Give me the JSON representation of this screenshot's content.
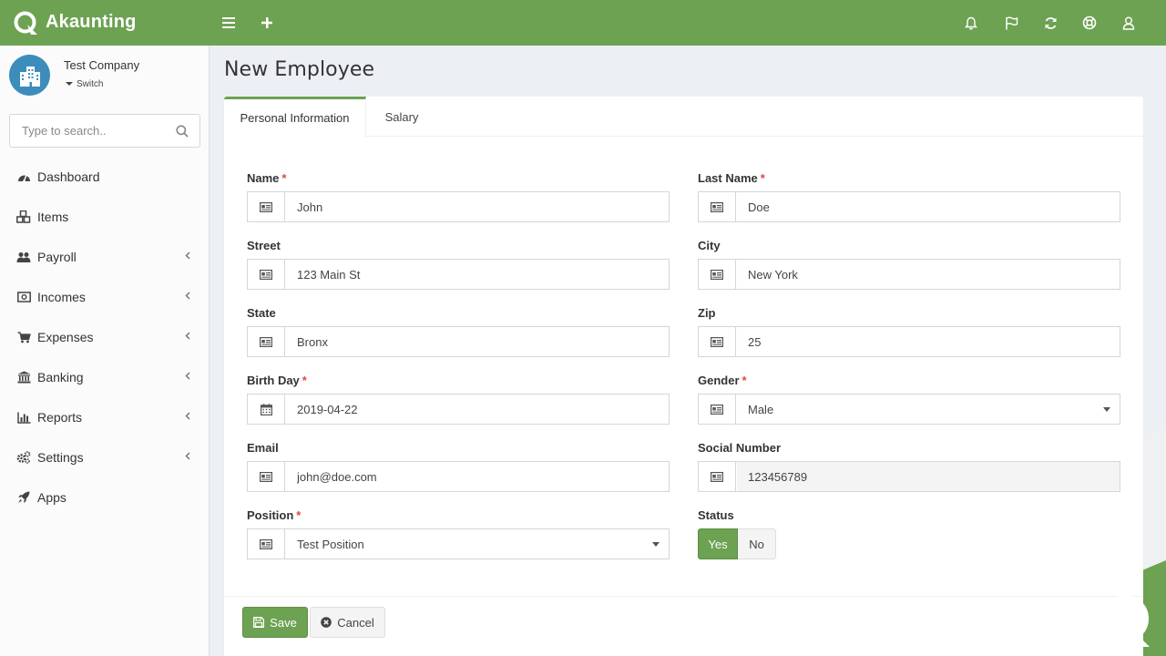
{
  "app": {
    "name": "Akaunting"
  },
  "colors": {
    "brand": "#6da252",
    "required": "#dd4b39",
    "avatar": "#3c8dbc"
  },
  "topbar": {
    "icons": [
      "menu-icon",
      "plus-icon",
      "bell-icon",
      "flag-icon",
      "refresh-icon",
      "support-icon",
      "user-icon"
    ]
  },
  "sidebar": {
    "company": {
      "name": "Test Company",
      "switch_label": "Switch"
    },
    "search": {
      "placeholder": "Type to search.."
    },
    "items": [
      {
        "label": "Dashboard",
        "icon": "dashboard-icon",
        "has_children": false
      },
      {
        "label": "Items",
        "icon": "cubes-icon",
        "has_children": false
      },
      {
        "label": "Payroll",
        "icon": "users-icon",
        "has_children": true
      },
      {
        "label": "Incomes",
        "icon": "money-icon",
        "has_children": true
      },
      {
        "label": "Expenses",
        "icon": "cart-icon",
        "has_children": true
      },
      {
        "label": "Banking",
        "icon": "bank-icon",
        "has_children": true
      },
      {
        "label": "Reports",
        "icon": "bar-chart-icon",
        "has_children": true
      },
      {
        "label": "Settings",
        "icon": "cogs-icon",
        "has_children": true
      },
      {
        "label": "Apps",
        "icon": "rocket-icon",
        "has_children": false
      }
    ]
  },
  "page": {
    "title": "New Employee"
  },
  "tabs": [
    {
      "label": "Personal Information",
      "active": true
    },
    {
      "label": "Salary",
      "active": false
    }
  ],
  "form": {
    "name": {
      "label": "Name",
      "required": "*",
      "value": "John"
    },
    "last_name": {
      "label": "Last Name",
      "required": "*",
      "value": "Doe"
    },
    "street": {
      "label": "Street",
      "value": "123 Main St"
    },
    "city": {
      "label": "City",
      "value": "New York"
    },
    "state": {
      "label": "State",
      "value": "Bronx"
    },
    "zip": {
      "label": "Zip",
      "value": "25"
    },
    "birth_day": {
      "label": "Birth Day",
      "required": "*",
      "value": "2019-04-22"
    },
    "gender": {
      "label": "Gender",
      "required": "*",
      "value": "Male"
    },
    "email": {
      "label": "Email",
      "value": "john@doe.com"
    },
    "social_number": {
      "label": "Social Number",
      "value": "123456789"
    },
    "position": {
      "label": "Position",
      "required": "*",
      "value": "Test Position"
    },
    "status": {
      "label": "Status",
      "yes": "Yes",
      "no": "No",
      "selected": "Yes"
    }
  },
  "actions": {
    "save": "Save",
    "cancel": "Cancel"
  }
}
